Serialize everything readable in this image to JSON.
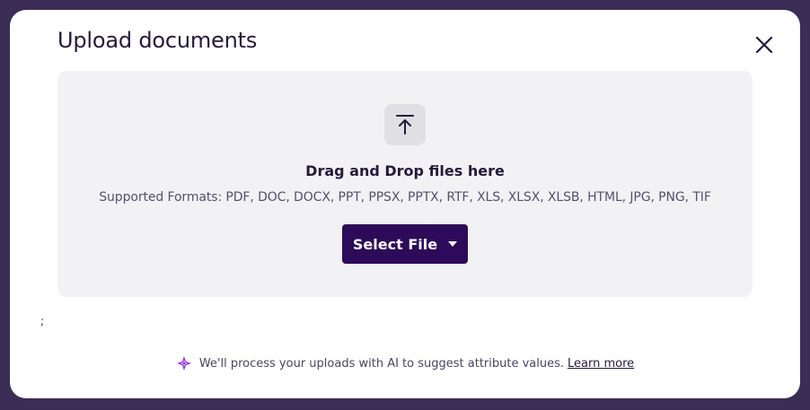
{
  "modal": {
    "title": "Upload documents",
    "close_icon": "close-icon"
  },
  "dropzone": {
    "icon": "upload-icon",
    "title": "Drag and Drop files here",
    "formats": "Supported Formats: PDF, DOC, DOCX, PPT, PPSX, PPTX, RTF, XLS, XLSX, XLSB, HTML, JPG, PNG, TIF",
    "select_button": "Select File",
    "select_caret_icon": "caret-down-icon"
  },
  "stray_text": ";",
  "footer": {
    "ai_icon": "ai-sparkle-icon",
    "message": "We'll process your uploads with AI to suggest attribute values.",
    "link": "Learn more"
  },
  "colors": {
    "backdrop": "#3b2d55",
    "primary_button": "#2d0a5a",
    "dropzone_bg": "#f2f2f5",
    "ai_icon": "#8a2be2"
  }
}
